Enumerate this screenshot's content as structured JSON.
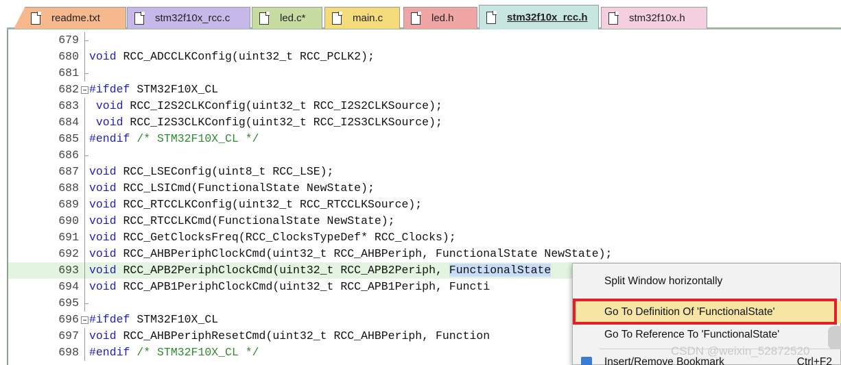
{
  "tabs": [
    {
      "label": "readme.txt",
      "color": "#f5b98d"
    },
    {
      "label": "stm32f10x_rcc.c",
      "color": "#c6b8e8"
    },
    {
      "label": "led.c*",
      "color": "#c7dca0"
    },
    {
      "label": "main.c",
      "color": "#f5dc7a"
    },
    {
      "label": "led.h",
      "color": "#f0a5a5"
    },
    {
      "label": "stm32f10x_rcc.h",
      "color": "#c8e6e0",
      "active": true
    },
    {
      "label": "stm32f10x.h",
      "color": "#f4cfe0"
    }
  ],
  "editor": {
    "lines": [
      {
        "num": "679",
        "parts": []
      },
      {
        "num": "680",
        "parts": [
          {
            "t": "kw",
            "s": "void"
          },
          {
            "t": "",
            "s": " RCC_ADCCLKConfig(uint32_t RCC_PCLK2);"
          }
        ]
      },
      {
        "num": "681",
        "parts": []
      },
      {
        "num": "682",
        "fold": true,
        "parts": [
          {
            "t": "pp",
            "s": "#ifdef"
          },
          {
            "t": "",
            "s": " STM32F10X_CL"
          }
        ]
      },
      {
        "num": "683",
        "parts": [
          {
            "t": "",
            "s": " "
          },
          {
            "t": "kw",
            "s": "void"
          },
          {
            "t": "",
            "s": " RCC_I2S2CLKConfig(uint32_t RCC_I2S2CLKSource);"
          }
        ]
      },
      {
        "num": "684",
        "parts": [
          {
            "t": "",
            "s": " "
          },
          {
            "t": "kw",
            "s": "void"
          },
          {
            "t": "",
            "s": " RCC_I2S3CLKConfig(uint32_t RCC_I2S3CLKSource);"
          }
        ]
      },
      {
        "num": "685",
        "parts": [
          {
            "t": "pp",
            "s": "#endif"
          },
          {
            "t": "",
            "s": " "
          },
          {
            "t": "cm",
            "s": "/* STM32F10X_CL */"
          }
        ]
      },
      {
        "num": "686",
        "parts": []
      },
      {
        "num": "687",
        "parts": [
          {
            "t": "kw",
            "s": "void"
          },
          {
            "t": "",
            "s": " RCC_LSEConfig(uint8_t RCC_LSE);"
          }
        ]
      },
      {
        "num": "688",
        "parts": [
          {
            "t": "kw",
            "s": "void"
          },
          {
            "t": "",
            "s": " RCC_LSICmd(FunctionalState NewState);"
          }
        ]
      },
      {
        "num": "689",
        "parts": [
          {
            "t": "kw",
            "s": "void"
          },
          {
            "t": "",
            "s": " RCC_RTCCLKConfig(uint32_t RCC_RTCCLKSource);"
          }
        ]
      },
      {
        "num": "690",
        "parts": [
          {
            "t": "kw",
            "s": "void"
          },
          {
            "t": "",
            "s": " RCC_RTCCLKCmd(FunctionalState NewState);"
          }
        ]
      },
      {
        "num": "691",
        "parts": [
          {
            "t": "kw",
            "s": "void"
          },
          {
            "t": "",
            "s": " RCC_GetClocksFreq(RCC_ClocksTypeDef* RCC_Clocks);"
          }
        ]
      },
      {
        "num": "692",
        "parts": [
          {
            "t": "kw",
            "s": "void"
          },
          {
            "t": "",
            "s": " RCC_AHBPeriphClockCmd(uint32_t RCC_AHBPeriph, FunctionalState NewState);"
          }
        ]
      },
      {
        "num": "693",
        "current": true,
        "parts": [
          {
            "t": "kw",
            "s": "void"
          },
          {
            "t": "",
            "s": " RCC_APB2PeriphClockCmd(uint32_t RCC_APB2Periph, "
          },
          {
            "t": "sel",
            "s": "FunctionalState"
          }
        ]
      },
      {
        "num": "694",
        "parts": [
          {
            "t": "kw",
            "s": "void"
          },
          {
            "t": "",
            "s": " RCC_APB1PeriphClockCmd(uint32_t RCC_APB1Periph, Functi"
          }
        ]
      },
      {
        "num": "695",
        "parts": []
      },
      {
        "num": "696",
        "fold": true,
        "parts": [
          {
            "t": "pp",
            "s": "#ifdef"
          },
          {
            "t": "",
            "s": " STM32F10X_CL"
          }
        ]
      },
      {
        "num": "697",
        "parts": [
          {
            "t": "kw",
            "s": "void"
          },
          {
            "t": "",
            "s": " RCC_AHBPeriphResetCmd(uint32_t RCC_AHBPeriph, Function"
          }
        ]
      },
      {
        "num": "698",
        "parts": [
          {
            "t": "pp",
            "s": "#endif"
          },
          {
            "t": "",
            "s": " "
          },
          {
            "t": "cm",
            "s": "/* STM32F10X_CL */"
          }
        ]
      }
    ]
  },
  "context_menu": {
    "items": [
      {
        "label": "Split Window horizontally"
      },
      {
        "label": "Go To Definition Of 'FunctionalState'",
        "highlighted": true
      },
      {
        "label": "Go To Reference To 'FunctionalState'"
      },
      {
        "label": "Insert/Remove Bookmark",
        "shortcut": "Ctrl+F2"
      }
    ]
  },
  "watermark": "CSDN @weixin_52872520"
}
